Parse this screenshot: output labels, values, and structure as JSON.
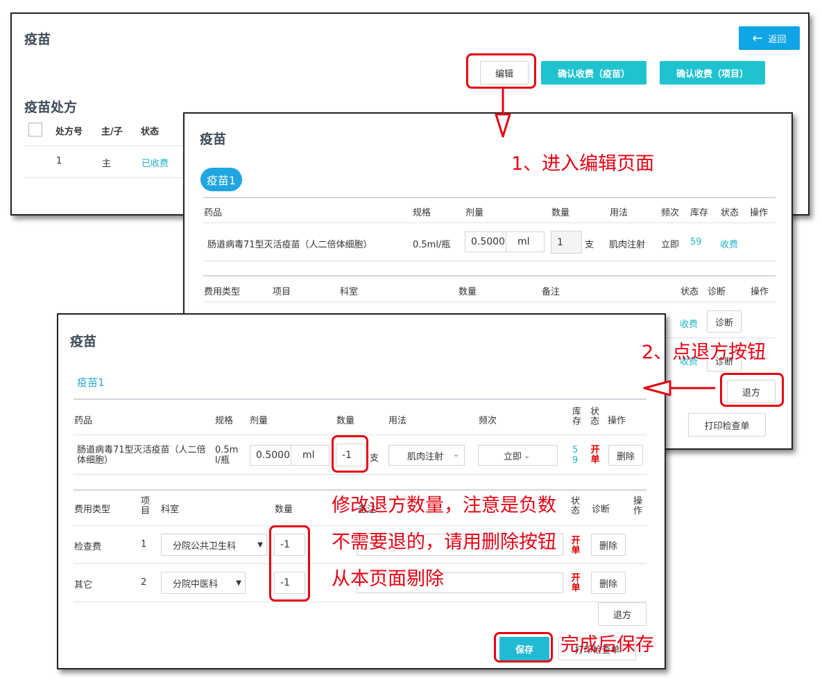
{
  "p1": {
    "title": "疫苗",
    "back_label": "返回",
    "edit_label": "编辑",
    "confirm_vaccine_label": "确认收费（疫苗）",
    "confirm_item_label": "确认收费（项目）",
    "section_title": "疫苗处方",
    "columns": [
      "处方号",
      "主/子",
      "状态"
    ],
    "row": {
      "no": "1",
      "type": "主",
      "status": "已收费"
    }
  },
  "p2": {
    "title": "疫苗",
    "tab": "疫苗1",
    "drug_headers": [
      "药品",
      "规格",
      "剂量",
      "数量",
      "用法",
      "频次",
      "库存",
      "状态",
      "操作"
    ],
    "drug": {
      "name": "肠道病毒71型灭活疫苗（人二倍体细胞）",
      "spec": "0.5ml/瓶",
      "dose": "0.5000",
      "dose_unit": "ml",
      "qty": "1",
      "qty_unit": "支",
      "usage": "肌肉注射",
      "freq": "立即",
      "stock": "59",
      "status": "收费"
    },
    "fee_headers": [
      "费用类型",
      "项目",
      "科室",
      "数量",
      "备注",
      "状态",
      "诊断",
      "操作"
    ],
    "fee_rows": [
      {
        "status": "收费",
        "diag": "诊断"
      },
      {
        "status": "收费",
        "diag": "诊断"
      }
    ],
    "refund_label": "退方",
    "print_label": "打印检查单"
  },
  "p3": {
    "title": "疫苗",
    "tab": "疫苗1",
    "drug_headers": {
      "drug": "药品",
      "spec": "规格",
      "dose": "剂量",
      "qty": "数量",
      "usage": "用法",
      "freq": "频次",
      "stock1": "库",
      "stock2": "存",
      "status1": "状",
      "status2": "态",
      "op": "操作"
    },
    "drug": {
      "name": "肠道病毒71型灭活疫苗（人二倍体细胞）",
      "spec": "0.5ml/瓶",
      "dose": "0.5000",
      "dose_unit": "ml",
      "qty": "-1",
      "qty_unit": "支",
      "usage": "肌肉注射",
      "freq": "立即",
      "stock1": "5",
      "stock2": "9",
      "status1": "开",
      "status2": "单",
      "delete": "删除"
    },
    "fee_headers": {
      "type": "费用类型",
      "item1": "项",
      "item2": "目",
      "dept": "科室",
      "qty": "数量",
      "note": "备注",
      "status1": "状",
      "status2": "态",
      "diag": "诊断",
      "op1": "操",
      "op2": "作"
    },
    "fee_rows": [
      {
        "type": "检查费",
        "item": "1",
        "dept": "分院公共卫生科",
        "qty": "-1",
        "status1": "开",
        "status2": "单",
        "delete": "删除"
      },
      {
        "type": "其它",
        "item": "2",
        "dept": "分院中医科",
        "qty": "-1",
        "status1": "开",
        "status2": "单",
        "delete": "删除"
      }
    ],
    "refund_label": "退方",
    "save_label": "保存",
    "print_label": "打印检查单"
  },
  "annotations": {
    "step1": "1、进入编辑页面",
    "step2": "2、点退方按钮",
    "note1": "修改退方数量，注意是负数",
    "note2": "不需要退的，请用删除按钮",
    "note3": "从本页面剔除",
    "note4": "完成后保存"
  },
  "colors": {
    "teal": "#1fc3cf",
    "blue": "#0fa5e6",
    "annotation_red": "#e60012",
    "status_red": "#e00000"
  }
}
